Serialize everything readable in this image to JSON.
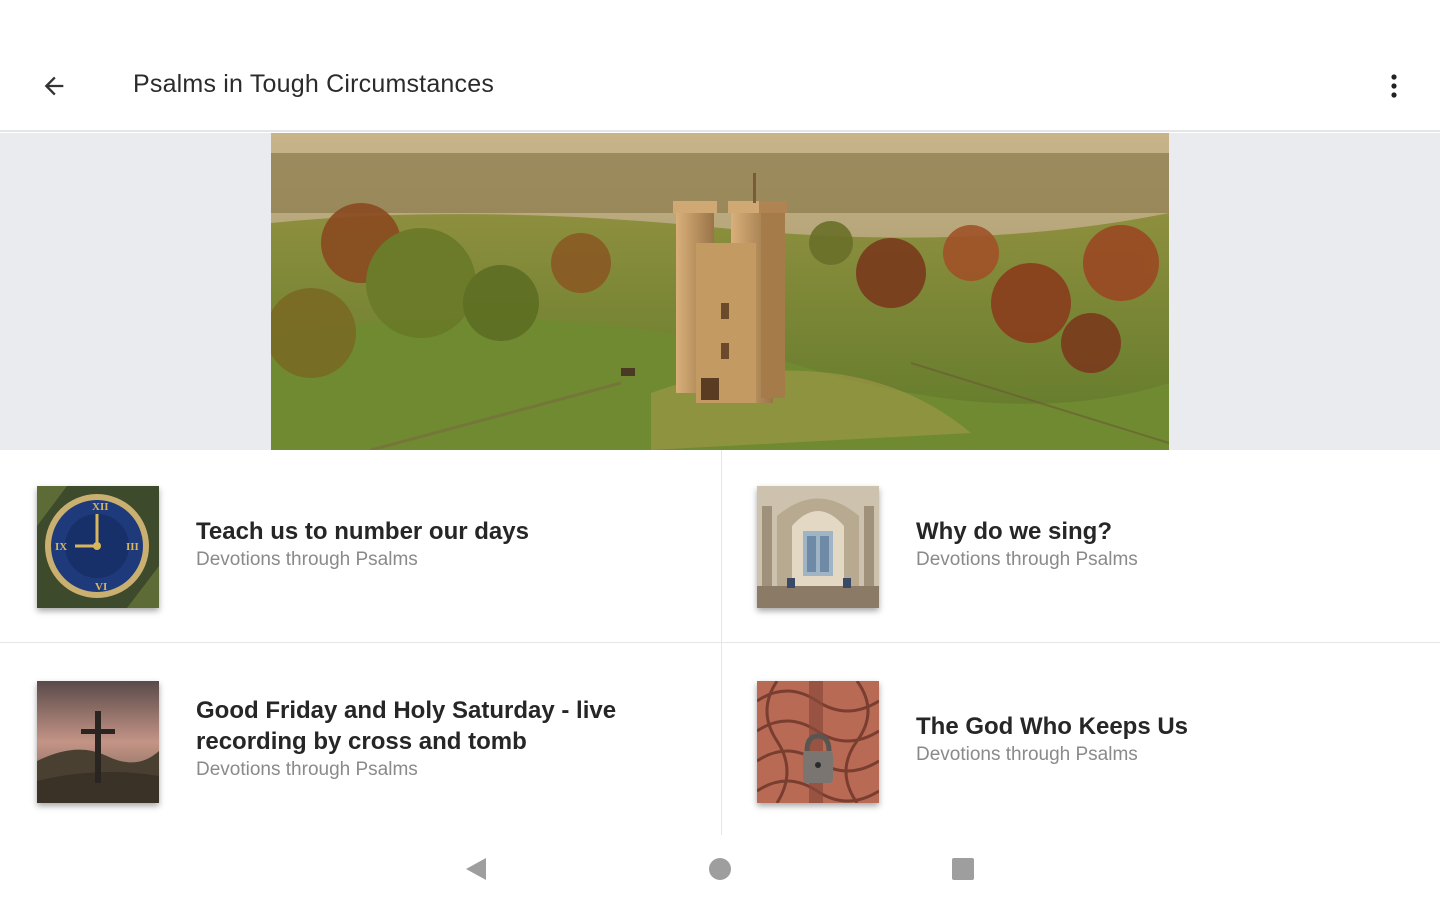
{
  "app_bar": {
    "title": "Psalms in Tough Circumstances",
    "back_icon": "arrow-left-icon",
    "menu_icon": "more-vert-icon"
  },
  "hero": {
    "image": "castle-tower-landscape"
  },
  "items": [
    {
      "title": "Teach us to number our days",
      "subtitle": "Devotions through Psalms",
      "thumb": "clock-face"
    },
    {
      "title": "Why do we sing?",
      "subtitle": "Devotions through Psalms",
      "thumb": "cathedral-interior"
    },
    {
      "title": "Good Friday and Holy Saturday - live recording by cross and tomb",
      "subtitle": "Devotions through Psalms",
      "thumb": "cross-on-hill"
    },
    {
      "title": "The God Who Keeps Us",
      "subtitle": "Devotions through Psalms",
      "thumb": "padlock-door"
    }
  ],
  "nav": {
    "back_icon": "nav-back-icon",
    "home_icon": "nav-home-icon",
    "recents_icon": "nav-recents-icon"
  },
  "colors": {
    "divider": "#e6e6e6",
    "hero_band": "#e9ebee",
    "subtitle": "#8a8a8a"
  }
}
